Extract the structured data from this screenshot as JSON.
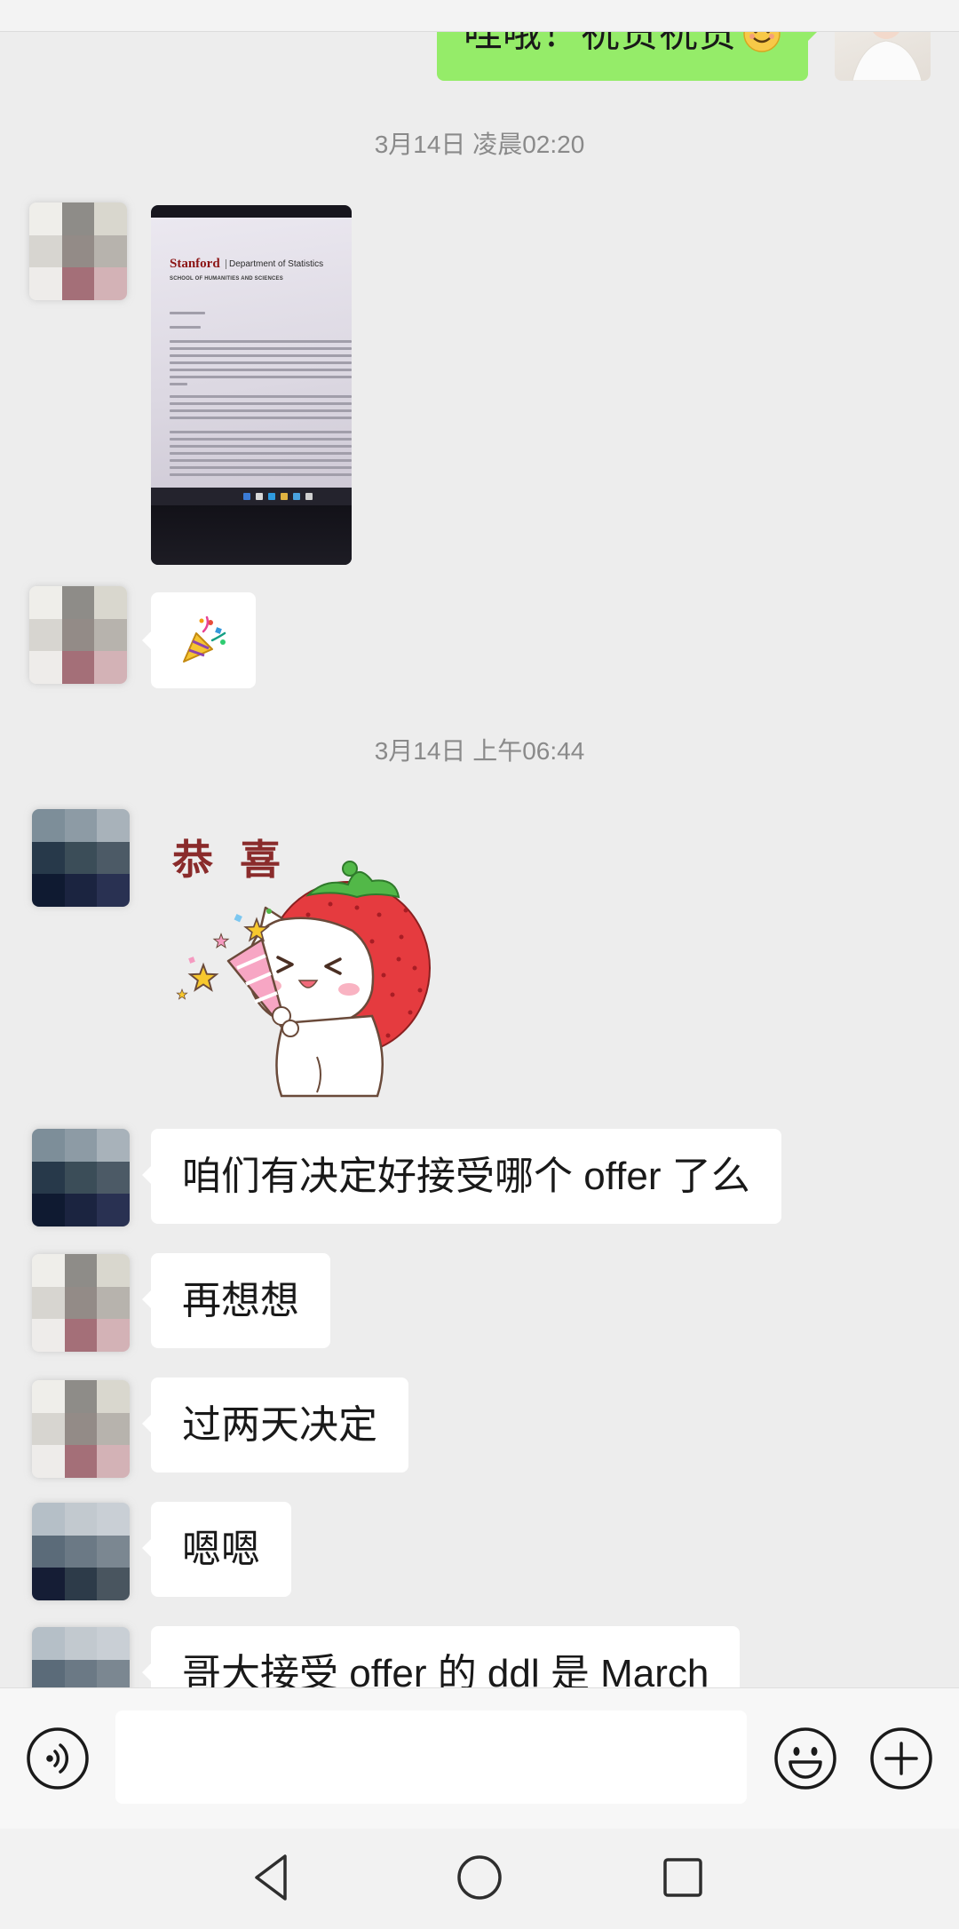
{
  "conversation": {
    "top_message": {
      "text": "哇哦！祝贺祝贺",
      "emoji": "smiling-face-emoji"
    },
    "timestamp_1": "3月14日 凌晨02:20",
    "image_message": {
      "brand": "Stanford",
      "department": "Department of Statistics",
      "school": "SCHOOL OF HUMANITIES AND SCIENCES"
    },
    "sticker_party": {
      "icon": "party-popper-icon"
    },
    "timestamp_2": "3月14日 上午06:44",
    "sticker_congrats": {
      "text": "恭喜",
      "icon": "strawberry-cat-sticker"
    },
    "messages": [
      {
        "text": "咱们有决定好接受哪个 offer 了么"
      },
      {
        "text": "再想想"
      },
      {
        "text": "过两天决定"
      },
      {
        "text": "嗯嗯"
      },
      {
        "text": "哥大接受 offer 的 ddl 是 March"
      }
    ]
  },
  "avatar_mosaics": {
    "a": [
      "#efeeea",
      "#8e8c88",
      "#d9d7ce",
      "#d7d5d0",
      "#938b87",
      "#b7b3ad",
      "#eeecea",
      "#a46f78",
      "#d3b2b6"
    ],
    "b": [
      "#7d8e99",
      "#8d9ba5",
      "#a8b2ba",
      "#27394a",
      "#3b4d58",
      "#4c5a66",
      "#0f1a31",
      "#1b2440",
      "#293152"
    ],
    "c": [
      "#b5bfc7",
      "#c2c9cf",
      "#c9cfd5",
      "#5b6b79",
      "#6b7985",
      "#7b8791",
      "#151d35",
      "#2d3b49",
      "#49555f"
    ]
  },
  "input_bar": {
    "input_value": "",
    "icons": [
      "voice-icon",
      "emoji-icon",
      "plus-icon"
    ]
  },
  "nav_bar": {
    "icons": [
      "back-icon",
      "home-icon",
      "recents-icon"
    ]
  },
  "colors": {
    "chat_background": "#ededed",
    "bubble_white": "#ffffff",
    "bubble_green": "#95ec69",
    "timestamp_text": "#8a8a8a"
  }
}
